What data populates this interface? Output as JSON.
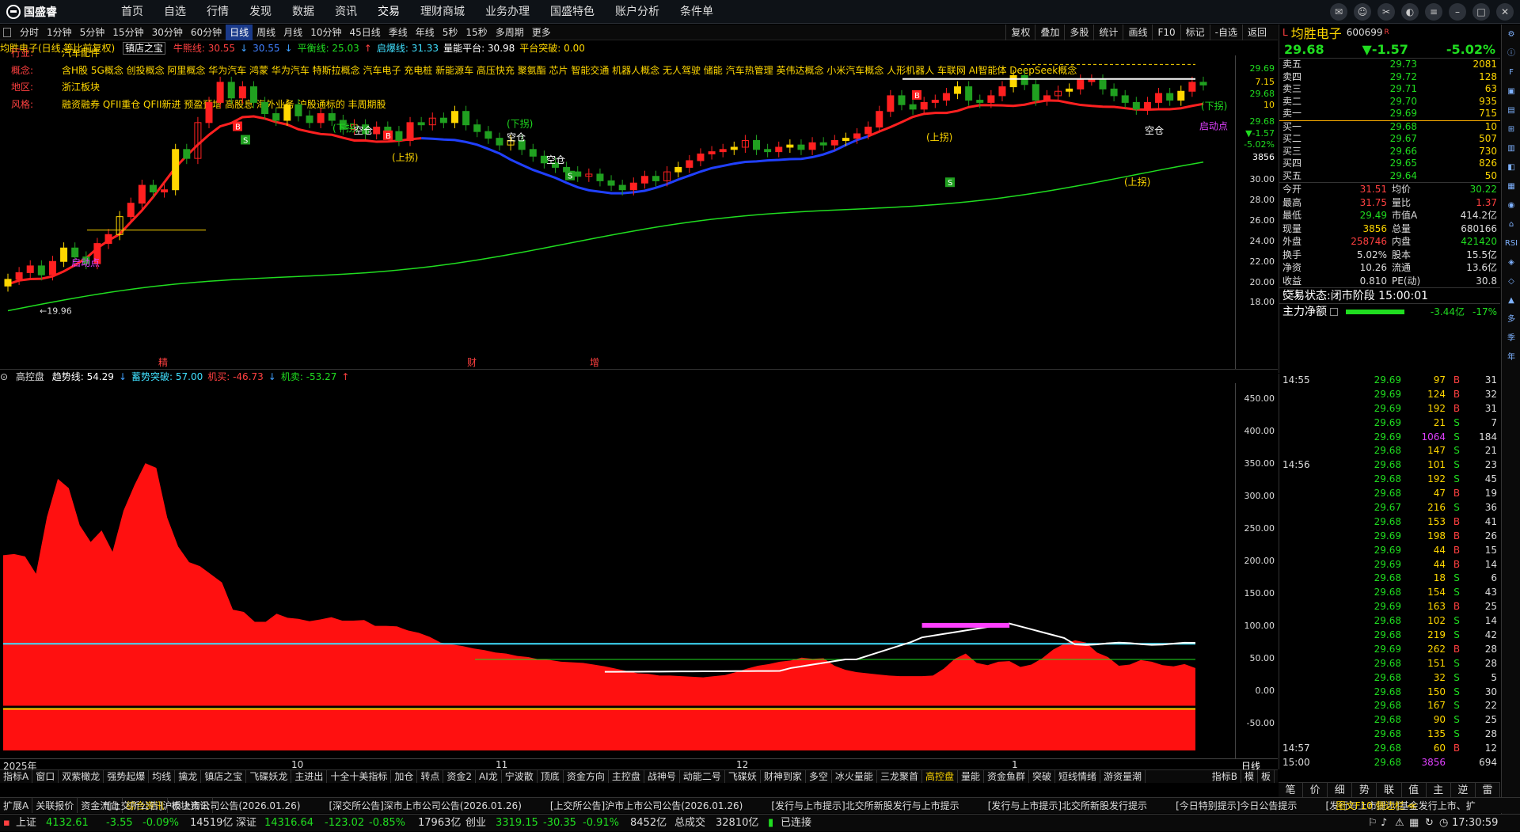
{
  "app": {
    "logo": "国盛睿"
  },
  "menu": [
    "首页",
    "自选",
    "行情",
    "发现",
    "数据",
    "资讯",
    "交易",
    "理财商城",
    "业务办理",
    "国盛特色",
    "账户分析",
    "条件单"
  ],
  "periods": [
    "分时",
    "1分钟",
    "5分钟",
    "15分钟",
    "30分钟",
    "60分钟",
    "日线",
    "周线",
    "月线",
    "10分钟",
    "45日线",
    "季线",
    "年线",
    "5秒",
    "15秒",
    "多周期",
    "更多"
  ],
  "period_selected": "日线",
  "toolbar_right": [
    "复权",
    "叠加",
    "多股",
    "统计",
    "画线",
    "F10",
    "标记",
    "-自选",
    "返回"
  ],
  "kline_info": {
    "name": "均胜电子(日线,等比前复权)",
    "indicator": "镇店之宝",
    "items": [
      {
        "t": "牛熊线: 30.55",
        "c": "#ff4040"
      },
      {
        "t": "↓",
        "c": "#40a0ff"
      },
      {
        "t": "30.55",
        "c": "#4080ff"
      },
      {
        "t": "↓",
        "c": "#40a0ff"
      },
      {
        "t": "平衡线: 25.03",
        "c": "#20dd20"
      },
      {
        "t": "↑",
        "c": "#ff4040"
      },
      {
        "t": "启爆线: 31.33",
        "c": "#40e0ff"
      },
      {
        "t": "量能平台: 30.98",
        "c": "#fff"
      },
      {
        "t": "平台突破: 0.00",
        "c": "#ffd700"
      }
    ]
  },
  "profile": [
    {
      "k": "行业:",
      "v": "汽车配件"
    },
    {
      "k": "概念:",
      "v": "含H股 5G概念 创投概念 阿里概念 华为汽车 鸿蒙 华为汽车 特斯拉概念 汽车电子 充电桩 新能源车 高压快充 聚氨酯 芯片 智能交通 机器人概念 无人驾驶 储能 汽车热管理 英伟达概念 小米汽车概念 人形机器人 车联网 AI智能体 DeepSeek概念"
    },
    {
      "k": "地区:",
      "v": "浙江板块"
    },
    {
      "k": "风格:",
      "v": "融资融券 QFII重仓 QFII新进 预盈预增 高股息 海外业务 沪股通标的 丰周期股"
    }
  ],
  "y_axis_main": [
    "29.69",
    "7.15",
    "29.68",
    "10",
    "29.68",
    "▼-1.57",
    "-5.02%",
    "3856",
    "30.00",
    "28.00",
    "26.00",
    "24.00",
    "22.00",
    "20.00",
    "18.00"
  ],
  "y_axis_ind": [
    "450.00",
    "400.00",
    "350.00",
    "300.00",
    "250.00",
    "200.00",
    "150.00",
    "100.00",
    "50.00",
    "0.00",
    "-50.00"
  ],
  "chart_labels": {
    "low": "←19.96",
    "markers": [
      "精",
      "财",
      "增"
    ],
    "callouts": [
      "(下拐)",
      "(上拐)",
      "(下拐)",
      "(上拐)",
      "(下拐)",
      "(上拐)",
      "空仓",
      "空仓",
      "空仓",
      "空仓",
      "启动点",
      "启动点"
    ]
  },
  "chart_data": {
    "type": "candlestick",
    "title": "均胜电子(日线,等比前复权)",
    "ylim": [
      17,
      31
    ],
    "last": 29.68,
    "low": 19.96,
    "bull_bear_line": 30.55,
    "balance_line": 25.03,
    "trigger_line": 31.33,
    "closes": [
      21.0,
      21.3,
      21.6,
      21.2,
      21.8,
      22.4,
      22.0,
      21.7,
      22.6,
      23.0,
      23.8,
      24.4,
      25.2,
      24.9,
      25.0,
      26.8,
      26.4,
      28.0,
      28.9,
      29.8,
      29.1,
      29.6,
      28.9,
      28.4,
      28.1,
      28.8,
      28.3,
      28.0,
      28.4,
      28.1,
      27.7,
      27.9,
      27.5,
      27.8,
      27.6,
      27.2,
      28.0,
      27.9,
      28.2,
      28.0,
      28.5,
      27.9,
      27.6,
      27.3,
      27.0,
      27.2,
      26.8,
      26.5,
      26.2,
      26.0,
      25.8,
      25.6,
      25.7,
      25.4,
      25.2,
      25.0,
      25.3,
      25.6,
      25.4,
      25.8,
      26.0,
      26.3,
      26.6,
      26.7,
      26.8,
      26.9,
      27.2,
      26.8,
      26.7,
      26.9,
      27.0,
      26.8,
      27.1,
      27.0,
      27.2,
      27.3,
      27.5,
      27.8,
      28.5,
      29.2,
      28.8,
      28.6,
      28.9,
      29.0,
      29.3,
      29.6,
      29.0,
      28.9,
      29.2,
      29.6,
      30.1,
      29.7,
      29.0,
      29.2,
      29.4,
      29.5,
      29.9,
      29.9,
      29.5,
      29.2,
      28.9,
      28.6,
      28.9,
      29.3,
      29.0,
      29.4,
      29.8,
      29.68
    ]
  },
  "ind2": {
    "name": "高控盘",
    "items": [
      {
        "t": "趋势线: 54.29",
        "c": "#fff"
      },
      {
        "t": "↓",
        "c": "#40a0ff"
      },
      {
        "t": "蓄势突破: 57.00",
        "c": "#40e0ff"
      },
      {
        "t": "机买: -46.73",
        "c": "#ff4040"
      },
      {
        "t": "↓",
        "c": "#40a0ff"
      },
      {
        "t": "机卖: -53.27",
        "c": "#20dd20"
      },
      {
        "t": "↑",
        "c": "#ff4040"
      }
    ],
    "area": [
      210,
      212,
      208,
      178,
      276,
      342,
      326,
      262,
      233,
      253,
      216,
      287,
      331,
      369,
      361,
      275,
      225,
      198,
      191,
      177,
      163,
      116,
      112,
      95,
      95,
      109,
      102,
      100,
      96,
      99,
      103,
      97,
      97,
      98,
      88,
      88,
      87,
      80,
      76,
      69,
      59,
      56,
      53,
      49,
      46,
      42,
      40,
      36,
      34,
      30,
      29,
      26,
      25,
      24,
      21,
      18,
      14,
      10,
      6,
      5,
      2,
      2,
      1,
      0,
      -1,
      1,
      3,
      8,
      14,
      19,
      22,
      26,
      28,
      33,
      31,
      32,
      19,
      12,
      8,
      6,
      4,
      2,
      1,
      1,
      1,
      2,
      14,
      31,
      40,
      24,
      20,
      26,
      27,
      17,
      21,
      32,
      47,
      57,
      63,
      59,
      42,
      34,
      19,
      21,
      29,
      26,
      20,
      18,
      22,
      15
    ]
  },
  "x_axis": [
    "2025年",
    "10",
    "11",
    "12",
    "1"
  ],
  "indicator_tabs": [
    "指标A",
    "窗口",
    "双紫橄龙",
    "强势起爆",
    "均线",
    "擒龙",
    "镇店之宝",
    "飞碟妖龙",
    "主进出",
    "十全十美指标",
    "加仓",
    "转点",
    "资金2",
    "AI龙",
    "宁波散",
    "顶底",
    "资金方向",
    "主控盘",
    "战神号",
    "动能二号",
    "飞碟妖",
    "财神到家",
    "多空",
    "冰火量能",
    "三龙聚首",
    "高控盘",
    "量能",
    "资金鱼群",
    "突破",
    "短线情绪",
    "游资量潮"
  ],
  "indicator_selected": "高控盘",
  "indicator_tabs_right": [
    "指标B",
    "模",
    "板"
  ],
  "quote": {
    "flag": "L",
    "name": "均胜电子",
    "code": "600699",
    "tag": "R",
    "price": "29.68",
    "change": "▼-1.57",
    "pct": "-5.02%",
    "asks": [
      [
        "卖五",
        "29.73",
        "2081"
      ],
      [
        "卖四",
        "29.72",
        "128"
      ],
      [
        "卖三",
        "29.71",
        "63"
      ],
      [
        "卖二",
        "29.70",
        "935"
      ],
      [
        "卖一",
        "29.69",
        "715"
      ]
    ],
    "bids": [
      [
        "买一",
        "29.68",
        "10"
      ],
      [
        "买二",
        "29.67",
        "507"
      ],
      [
        "买三",
        "29.66",
        "730"
      ],
      [
        "买四",
        "29.65",
        "826"
      ],
      [
        "买五",
        "29.64",
        "50"
      ]
    ],
    "stats": [
      [
        "今开",
        "31.51",
        "均价",
        "30.22"
      ],
      [
        "最高",
        "31.75",
        "量比",
        "1.37"
      ],
      [
        "最低",
        "29.49",
        "市值A",
        "414.2亿"
      ],
      [
        "现量",
        "3856",
        "总量",
        "680166"
      ],
      [
        "外盘",
        "258746",
        "内盘",
        "421420"
      ],
      [
        "换手",
        "5.02%",
        "股本",
        "15.5亿"
      ],
      [
        "净资",
        "10.26",
        "流通",
        "13.6亿"
      ],
      [
        "收益(三)",
        "0.810",
        "PE(动)",
        "30.8"
      ]
    ],
    "status_label": "交易状态:",
    "status": "闭市阶段 15:00:01",
    "flow_label": "主力净额",
    "flow_val": "-3.44亿",
    "flow_pct": "-17%"
  },
  "tape": [
    [
      "14:55",
      "29.69",
      "97",
      "B",
      "31"
    ],
    [
      "",
      "29.69",
      "124",
      "B",
      "32"
    ],
    [
      "",
      "29.69",
      "192",
      "B",
      "31"
    ],
    [
      "",
      "29.69",
      "21",
      "S",
      "7"
    ],
    [
      "",
      "29.69",
      "1064",
      "S",
      "184"
    ],
    [
      "",
      "29.68",
      "147",
      "S",
      "21"
    ],
    [
      "14:56",
      "29.68",
      "101",
      "S",
      "23"
    ],
    [
      "",
      "29.68",
      "192",
      "S",
      "45"
    ],
    [
      "",
      "29.68",
      "47",
      "B",
      "19"
    ],
    [
      "",
      "29.67",
      "216",
      "S",
      "36"
    ],
    [
      "",
      "29.68",
      "153",
      "B",
      "41"
    ],
    [
      "",
      "29.69",
      "198",
      "B",
      "26"
    ],
    [
      "",
      "29.69",
      "44",
      "B",
      "15"
    ],
    [
      "",
      "29.69",
      "44",
      "B",
      "14"
    ],
    [
      "",
      "29.68",
      "18",
      "S",
      "6"
    ],
    [
      "",
      "29.68",
      "154",
      "S",
      "43"
    ],
    [
      "",
      "29.69",
      "163",
      "B",
      "25"
    ],
    [
      "",
      "29.68",
      "102",
      "S",
      "14"
    ],
    [
      "",
      "29.68",
      "219",
      "S",
      "42"
    ],
    [
      "",
      "29.69",
      "262",
      "B",
      "28"
    ],
    [
      "",
      "29.68",
      "151",
      "S",
      "28"
    ],
    [
      "",
      "29.68",
      "32",
      "S",
      "5"
    ],
    [
      "",
      "29.68",
      "150",
      "S",
      "30"
    ],
    [
      "",
      "29.68",
      "167",
      "S",
      "22"
    ],
    [
      "",
      "29.68",
      "90",
      "S",
      "25"
    ],
    [
      "",
      "29.68",
      "135",
      "S",
      "28"
    ],
    [
      "14:57",
      "29.68",
      "60",
      "B",
      "12"
    ],
    [
      "15:00",
      "29.68",
      "3856",
      "",
      "694"
    ]
  ],
  "trade_tabs": [
    "笔",
    "价",
    "细",
    "势",
    "联",
    "值",
    "主",
    "逆",
    "雷"
  ],
  "side_tabs": [
    "⚙",
    "ⓘ",
    "F",
    "▣",
    "▤",
    "⊞",
    "▥",
    "◧",
    "▦",
    "◉",
    "⌂",
    "RSI",
    "◈",
    "◇",
    "▲",
    "多",
    "季",
    "年"
  ],
  "news_btns": [
    "扩展A",
    "关联报价",
    "资金流向",
    "综合资讯",
    "板块资讯"
  ],
  "news_btn_selected": "综合资讯",
  "news": [
    "*[上交所公告]沪市上市公司公告(2026.01.26)",
    "[深交所公告]深市上市公司公告(2026.01.26)",
    "[上交所公告]沪市上市公司公告(2026.01.26)",
    "[发行与上市提示]北交所新股发行与上市提示",
    "[发行与上市提示]北交所新股发行提示",
    "[今日特别提示]今日公告提示",
    "[发行与上市提示]基金发行上市、扩"
  ],
  "news_right": "图文F10 侧边栏 ≪",
  "status": {
    "sh": "上证",
    "sh_v": "4132.61",
    "sh_c": "-3.55",
    "sh_p": "-0.09%",
    "sh_a": "14519亿",
    "sz": "深证",
    "sz_v": "14316.64",
    "sz_c": "-123.02",
    "sz_p": "-0.85%",
    "sz_a": "17963亿",
    "cy": "创业",
    "cy_v": "3319.15",
    "cy_c": "-30.35",
    "cy_p": "-0.91%",
    "cy_a": "8452亿",
    "tot": "总成交",
    "tot_v": "32810亿",
    "conn": "已连接",
    "time": "17:30:59"
  }
}
